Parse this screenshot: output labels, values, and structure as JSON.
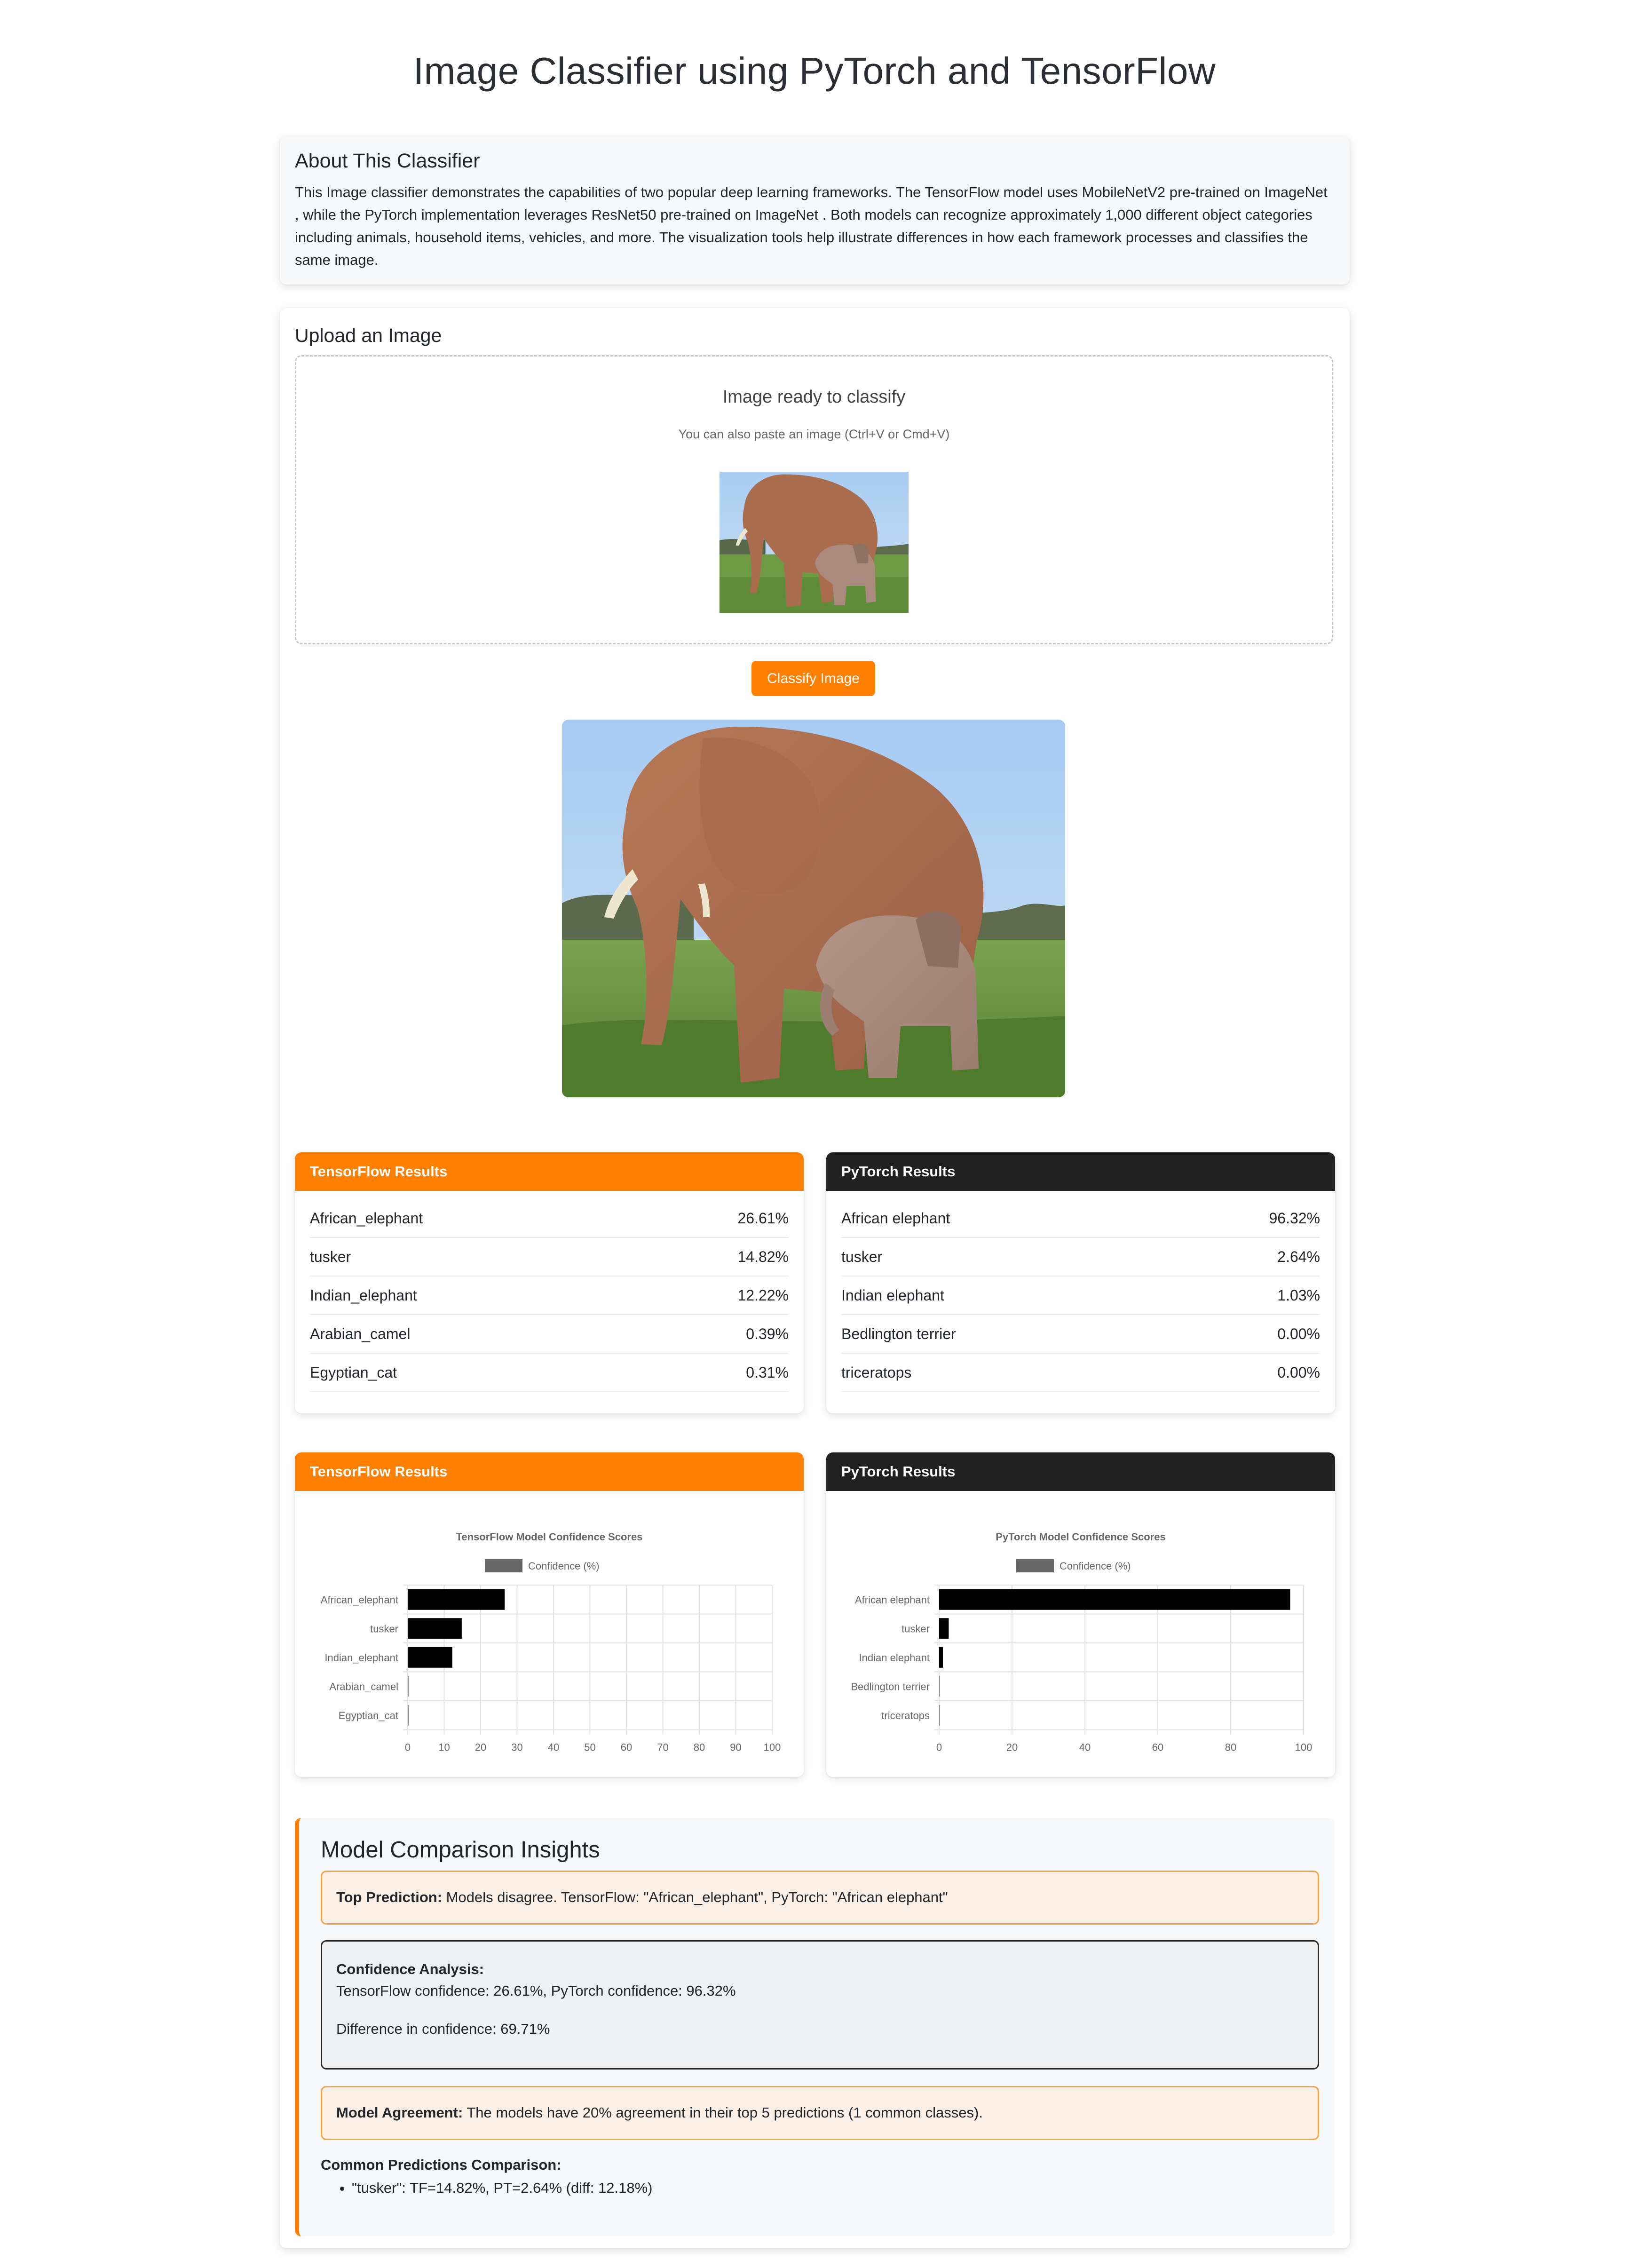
{
  "page": {
    "title": "Image Classifier using PyTorch and TensorFlow"
  },
  "about": {
    "title": "About This Classifier",
    "text": "This Image classifier demonstrates the capabilities of two popular deep learning frameworks. The TensorFlow model uses MobileNetV2 pre-trained on ImageNet , while the PyTorch implementation leverages ResNet50 pre-trained on ImageNet . Both models can recognize approximately 1,000 different object categories including animals, household items, vehicles, and more. The visualization tools help illustrate differences in how each framework processes and classifies the same image."
  },
  "upload": {
    "title": "Upload an Image",
    "status": "Image ready to classify",
    "hint": "You can also paste an image (Ctrl+V or Cmd+V)",
    "classify_label": "Classify Image"
  },
  "colors": {
    "tensorflow": "#ff7f00",
    "pytorch": "#212121",
    "bar": "#000000"
  },
  "tf_results": {
    "header": "TensorFlow Results",
    "rows": [
      {
        "label": "African_elephant",
        "value": "26.61%"
      },
      {
        "label": "tusker",
        "value": "14.82%"
      },
      {
        "label": "Indian_elephant",
        "value": "12.22%"
      },
      {
        "label": "Arabian_camel",
        "value": "0.39%"
      },
      {
        "label": "Egyptian_cat",
        "value": "0.31%"
      }
    ]
  },
  "pt_results": {
    "header": "PyTorch Results",
    "rows": [
      {
        "label": "African elephant",
        "value": "96.32%"
      },
      {
        "label": "tusker",
        "value": "2.64%"
      },
      {
        "label": "Indian elephant",
        "value": "1.03%"
      },
      {
        "label": "Bedlington terrier",
        "value": "0.00%"
      },
      {
        "label": "triceratops",
        "value": "0.00%"
      }
    ]
  },
  "chart_headers": {
    "tf": "TensorFlow Results",
    "pt": "PyTorch Results"
  },
  "chart_data": [
    {
      "type": "bar",
      "orientation": "horizontal",
      "title": "TensorFlow Model Confidence Scores",
      "legend": "Confidence (%)",
      "categories": [
        "African_elephant",
        "tusker",
        "Indian_elephant",
        "Arabian_camel",
        "Egyptian_cat"
      ],
      "values": [
        26.61,
        14.82,
        12.22,
        0.39,
        0.31
      ],
      "xlim": [
        0,
        100
      ],
      "xticks": [
        0,
        10,
        20,
        30,
        40,
        50,
        60,
        70,
        80,
        90,
        100
      ],
      "grid": true,
      "legend_position": "top"
    },
    {
      "type": "bar",
      "orientation": "horizontal",
      "title": "PyTorch Model Confidence Scores",
      "legend": "Confidence (%)",
      "categories": [
        "African elephant",
        "tusker",
        "Indian elephant",
        "Bedlington terrier",
        "triceratops"
      ],
      "values": [
        96.32,
        2.64,
        1.03,
        0.0,
        0.0
      ],
      "xlim": [
        0,
        100
      ],
      "xticks": [
        0,
        20,
        40,
        60,
        80,
        100
      ],
      "grid": true,
      "legend_position": "top"
    }
  ],
  "insights": {
    "title": "Model Comparison Insights",
    "top_label": "Top Prediction:",
    "top_text": " Models disagree. TensorFlow: \"African_elephant\", PyTorch: \"African elephant\"",
    "conf_label": "Confidence Analysis:",
    "conf_line1": "TensorFlow confidence: 26.61%, PyTorch confidence: 96.32%",
    "conf_line2": "Difference in confidence: 69.71%",
    "agree_label": "Model Agreement:",
    "agree_text": " The models have 20% agreement in their top 5 predictions (1 common classes).",
    "common_label": "Common Predictions Comparison:",
    "common_items": [
      "\"tusker\": TF=14.82%, PT=2.64% (diff: 12.18%)"
    ]
  }
}
